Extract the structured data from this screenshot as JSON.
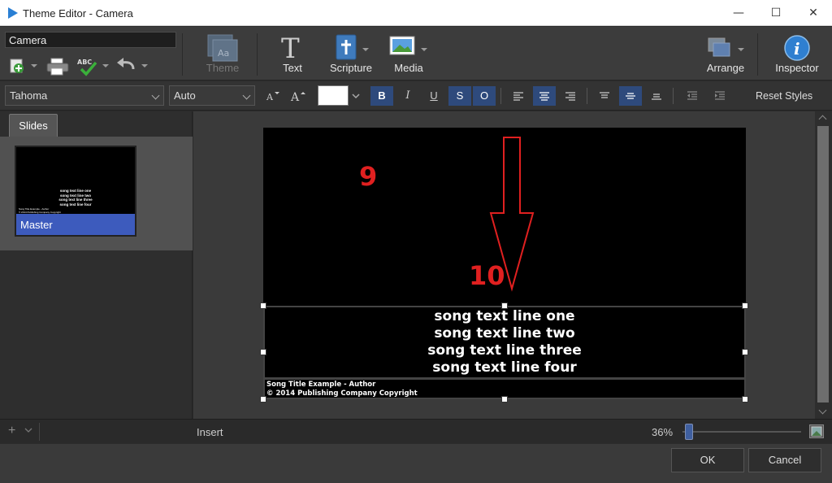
{
  "window": {
    "title": "Theme Editor - Camera",
    "minimize": "—",
    "maximize": "☐",
    "close": "✕"
  },
  "ribbon": {
    "theme_name": "Camera",
    "theme_label": "Theme",
    "text_label": "Text",
    "scripture_label": "Scripture",
    "media_label": "Media",
    "arrange_label": "Arrange",
    "inspector_label": "Inspector"
  },
  "format": {
    "font": "Tahoma",
    "size": "Auto",
    "bold": "B",
    "italic": "I",
    "underline": "U",
    "shadow": "S",
    "outline": "O",
    "reset_styles": "Reset Styles"
  },
  "sidebar": {
    "tab": "Slides",
    "thumb_label": "Master",
    "thumb_lines": [
      "song text line one",
      "song text line two",
      "song text line three",
      "song text line four"
    ],
    "thumb_footer": [
      "Song Title Example - Author",
      "© 2014 Publishing Company Copyright"
    ]
  },
  "slide": {
    "annotation_9": "9",
    "annotation_10": "10",
    "lines": [
      "song text line one",
      "song text line two",
      "song text line three",
      "song text line four"
    ],
    "footer": [
      "Song Title Example - Author",
      "© 2014 Publishing Company Copyright"
    ]
  },
  "bottom": {
    "add": "+",
    "insert": "Insert",
    "zoom": "36%",
    "zoom_level_fraction": 0.03
  },
  "dialog": {
    "ok": "OK",
    "cancel": "Cancel"
  },
  "colors": {
    "accent": "#3d5bbd",
    "annotation": "#e02020",
    "active_button": "#2e4a7c"
  }
}
